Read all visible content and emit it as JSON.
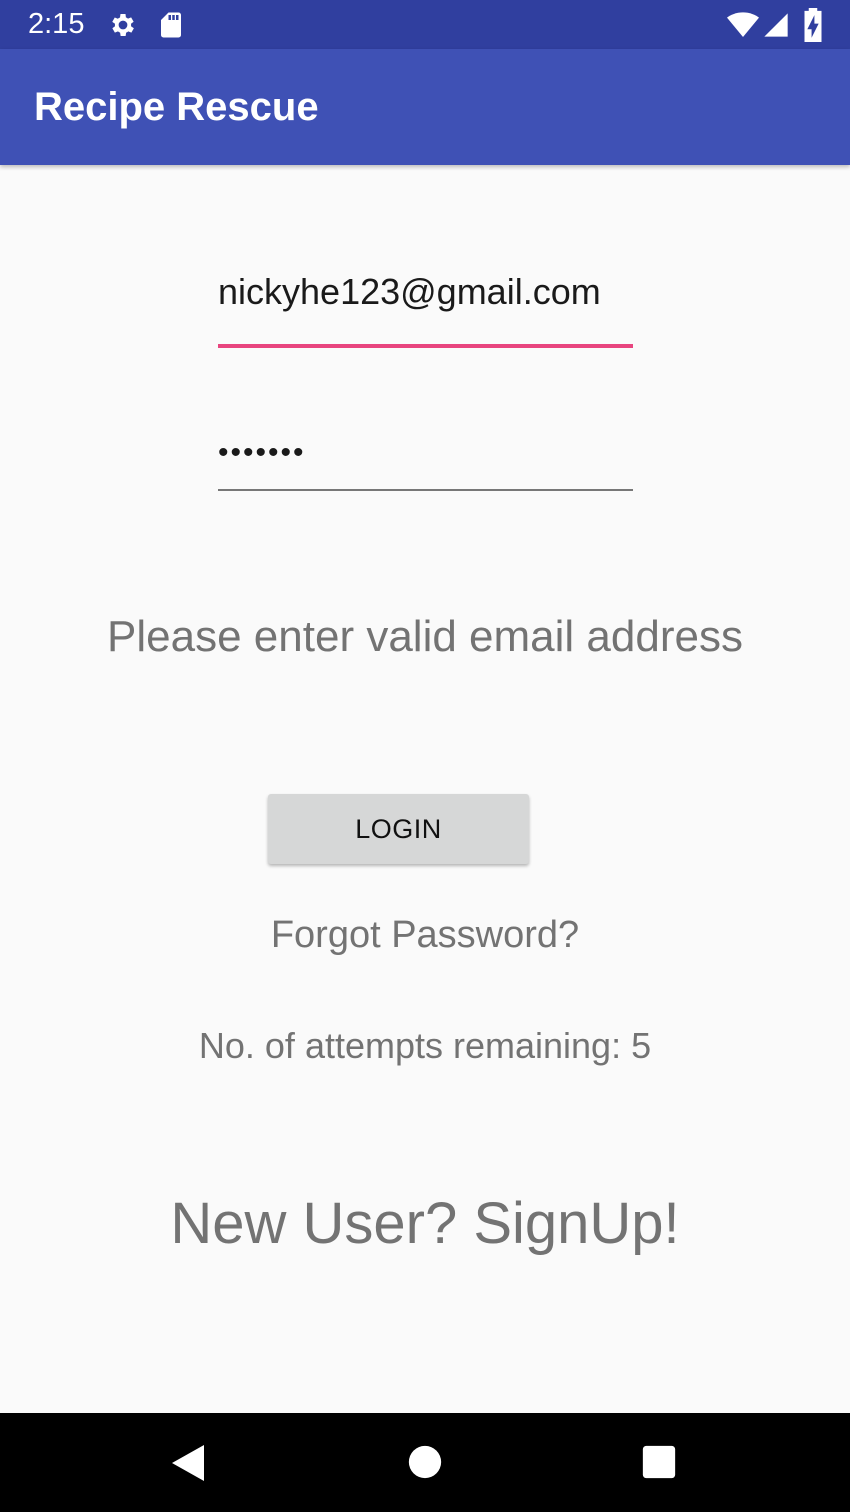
{
  "status_bar": {
    "time": "2:15",
    "icons": [
      "settings-gear-icon",
      "sd-card-icon",
      "wifi-icon",
      "cell-signal-icon",
      "battery-charging-icon"
    ]
  },
  "app_bar": {
    "title": "Recipe Rescue"
  },
  "login_form": {
    "email_value": "nickyhe123@gmail.com",
    "password_value": "•••••••",
    "error_message": "Please enter valid email address",
    "login_label": "LOGIN",
    "forgot_password": "Forgot Password?",
    "attempts_text": "No. of attempts remaining: 5",
    "signup_text": "New User? SignUp!"
  },
  "nav_bar": {
    "icons": [
      "back-icon",
      "home-icon",
      "recents-icon"
    ]
  },
  "colors": {
    "status_bar": "#303f9f",
    "app_bar": "#3f51b5",
    "accent": "#e8457f",
    "background": "#fafafa"
  }
}
